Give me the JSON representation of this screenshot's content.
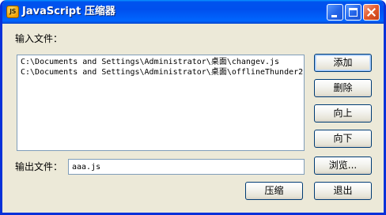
{
  "window": {
    "title": "JavaScript 压缩器",
    "icon": "js-app-icon",
    "icon_text": "JS",
    "controls": [
      "minimize-icon",
      "maximize-icon",
      "close-icon"
    ]
  },
  "input_section": {
    "label": "输入文件：",
    "files": [
      "C:\\Documents and Settings\\Administrator\\桌面\\changev.js",
      "C:\\Documents and Settings\\Administrator\\桌面\\offlineThunder2"
    ]
  },
  "output_section": {
    "label": "输出文件：",
    "value": "aaa.js"
  },
  "buttons": {
    "add": "添加",
    "delete": "删除",
    "up": "向上",
    "down": "向下",
    "browse": "浏览...",
    "compress": "压缩",
    "exit": "退出"
  },
  "colors": {
    "titlebar": "#0054e3",
    "window_border": "#0831d9",
    "dialog_background": "#ece9d8",
    "close_button": "#e35a2a",
    "field_border": "#7f9db9"
  }
}
